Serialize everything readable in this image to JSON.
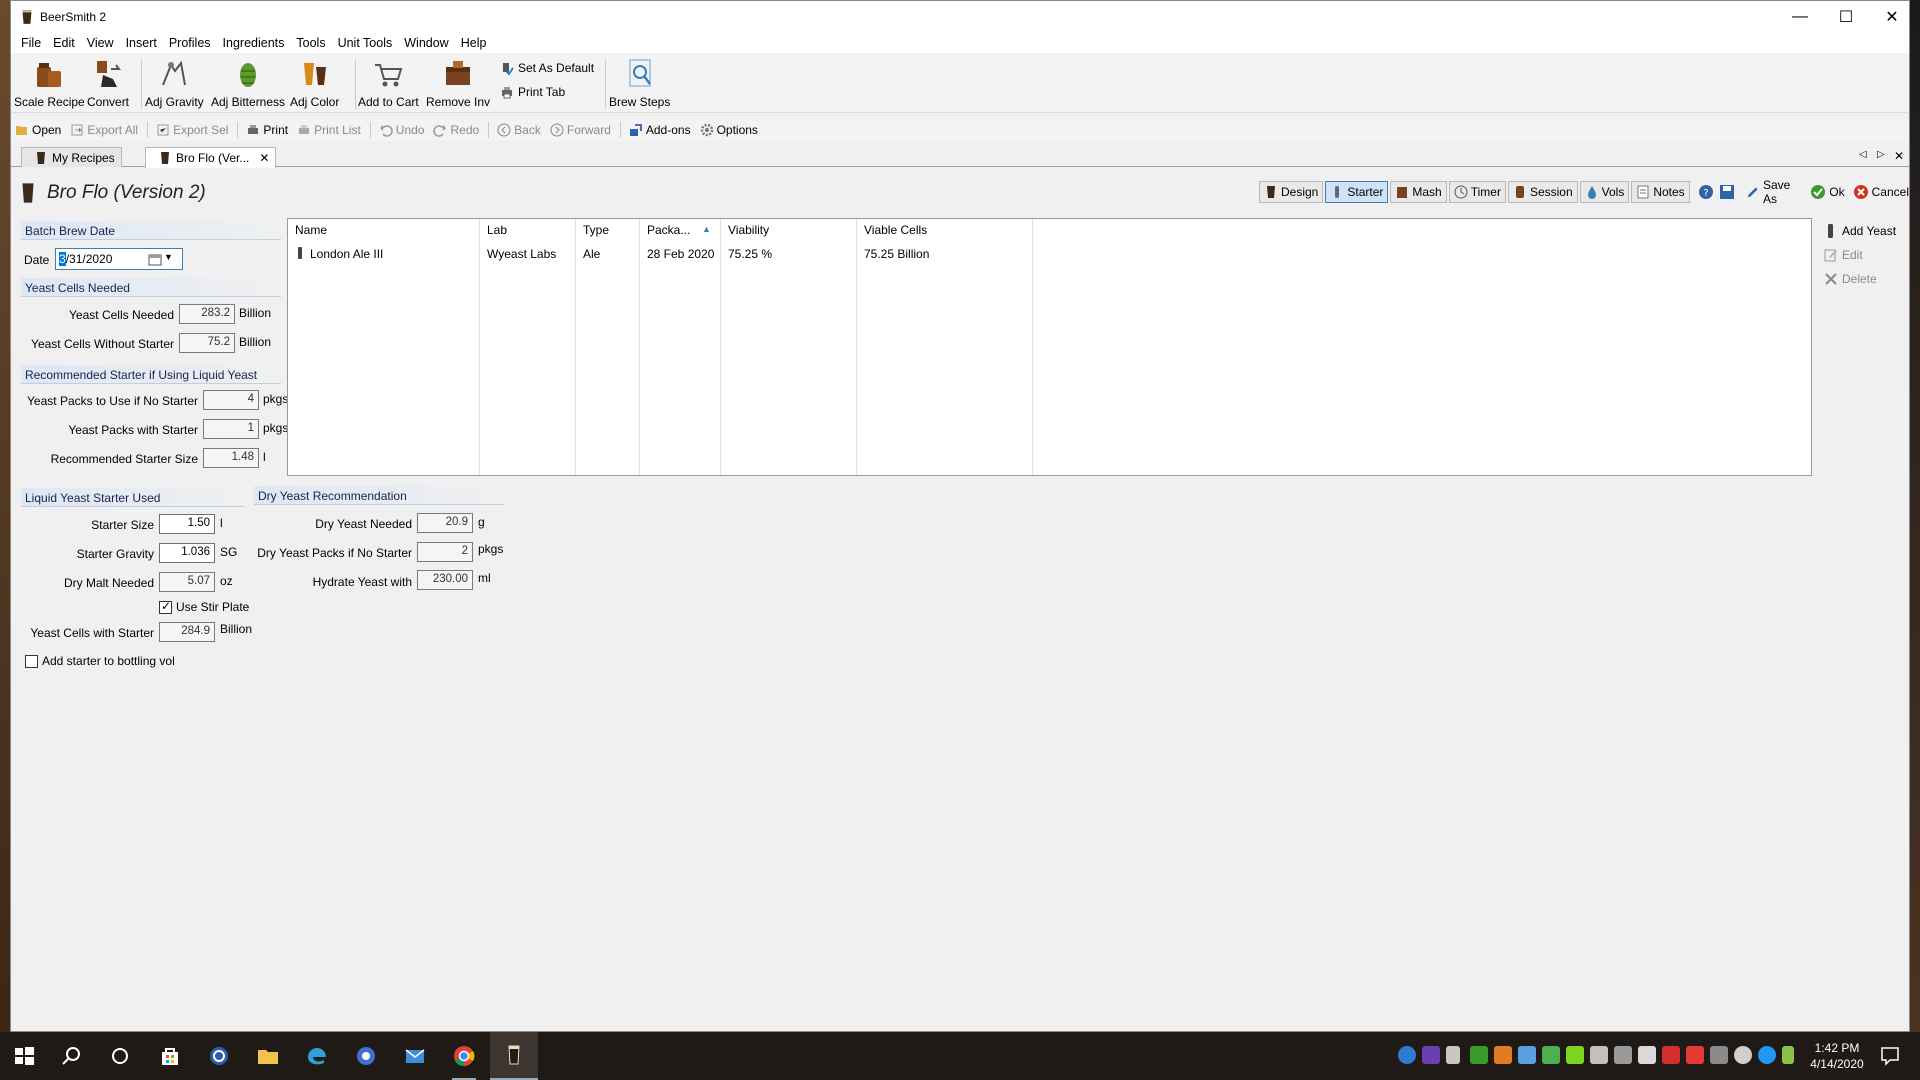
{
  "app": {
    "title": "BeerSmith 2"
  },
  "window_controls": {
    "minimize": "—",
    "maximize": "☐",
    "close": "✕"
  },
  "menu": [
    "File",
    "Edit",
    "View",
    "Insert",
    "Profiles",
    "Ingredients",
    "Tools",
    "Unit Tools",
    "Window",
    "Help"
  ],
  "ribbon": {
    "scale_recipe": "Scale Recipe",
    "convert": "Convert",
    "adj_gravity": "Adj Gravity",
    "adj_bitterness": "Adj Bitterness",
    "adj_color": "Adj Color",
    "add_to_cart": "Add to Cart",
    "remove_inv": "Remove Inv",
    "set_as_default": "Set As Default",
    "print_tab": "Print Tab",
    "brew_steps": "Brew Steps"
  },
  "toolbar": {
    "open": "Open",
    "export_all": "Export All",
    "export_sel": "Export Sel",
    "print": "Print",
    "print_list": "Print List",
    "undo": "Undo",
    "redo": "Redo",
    "back": "Back",
    "forward": "Forward",
    "addons": "Add-ons",
    "options": "Options"
  },
  "tabs": [
    {
      "label": "My Recipes",
      "active": false
    },
    {
      "label": "Bro Flo (Ver...",
      "active": true,
      "close": "✕"
    }
  ],
  "tab_nav": {
    "prev": "◁",
    "next": "▷",
    "close": "✕"
  },
  "recipe": {
    "title": "Bro Flo (Version 2)"
  },
  "views": {
    "design": "Design",
    "starter": "Starter",
    "mash": "Mash",
    "timer": "Timer",
    "session": "Session",
    "vols": "Vols",
    "notes": "Notes",
    "save_as": "Save As",
    "ok": "Ok",
    "cancel": "Cancel"
  },
  "batch": {
    "header": "Batch Brew Date",
    "date_label": "Date",
    "date_cursor": "3",
    "date_rest": "/31/2020"
  },
  "cells_needed": {
    "header": "Yeast Cells Needed",
    "needed_label": "Yeast Cells Needed",
    "needed_value": "283.2",
    "needed_unit": "Billion",
    "without_label": "Yeast Cells Without Starter",
    "without_value": "75.2",
    "without_unit": "Billion"
  },
  "recommended": {
    "header": "Recommended Starter if Using Liquid Yeast",
    "packs_no_starter_label": "Yeast Packs to Use if No Starter",
    "packs_no_starter_value": "4",
    "packs_no_starter_unit": "pkgs",
    "packs_with_starter_label": "Yeast Packs with Starter",
    "packs_with_starter_value": "1",
    "packs_with_starter_unit": "pkgs",
    "starter_size_label": "Recommended Starter Size",
    "starter_size_value": "1.48",
    "starter_size_unit": "l"
  },
  "liquid": {
    "header": "Liquid Yeast Starter Used",
    "size_label": "Starter Size",
    "size_value": "1.50",
    "size_unit": "l",
    "gravity_label": "Starter Gravity",
    "gravity_value": "1.036",
    "gravity_unit": "SG",
    "malt_label": "Dry Malt Needed",
    "malt_value": "5.07",
    "malt_unit": "oz",
    "stir_plate_label": "Use Stir Plate",
    "stir_plate_checked": true,
    "cells_with_label": "Yeast Cells with Starter",
    "cells_with_value": "284.9",
    "cells_with_unit": "Billion"
  },
  "dry": {
    "header": "Dry Yeast Recommendation",
    "needed_label": "Dry Yeast Needed",
    "needed_value": "20.9",
    "needed_unit": "g",
    "packs_label": "Dry Yeast Packs if No Starter",
    "packs_value": "2",
    "packs_unit": "pkgs",
    "hydrate_label": "Hydrate Yeast with",
    "hydrate_value": "230.00",
    "hydrate_unit": "ml"
  },
  "bottling": {
    "label": "Add starter to bottling vol",
    "checked": false
  },
  "yeast_table": {
    "columns": [
      "Name",
      "Lab",
      "Type",
      "Packa...",
      "Viability",
      "Viable Cells"
    ],
    "sort_indicator": "▲",
    "rows": [
      {
        "name": "London Ale III",
        "lab": "Wyeast Labs",
        "type": "Ale",
        "package": "28 Feb 2020",
        "viability": "75.25 %",
        "viable_cells": "75.25 Billion"
      }
    ]
  },
  "side_actions": {
    "add_yeast": "Add Yeast",
    "edit": "Edit",
    "delete": "Delete"
  },
  "taskbar": {
    "time": "1:42 PM",
    "date": "4/14/2020"
  },
  "colors": {
    "accent": "#0078d7",
    "section_head": "#dce8f5",
    "taskbar": "#201a16"
  }
}
